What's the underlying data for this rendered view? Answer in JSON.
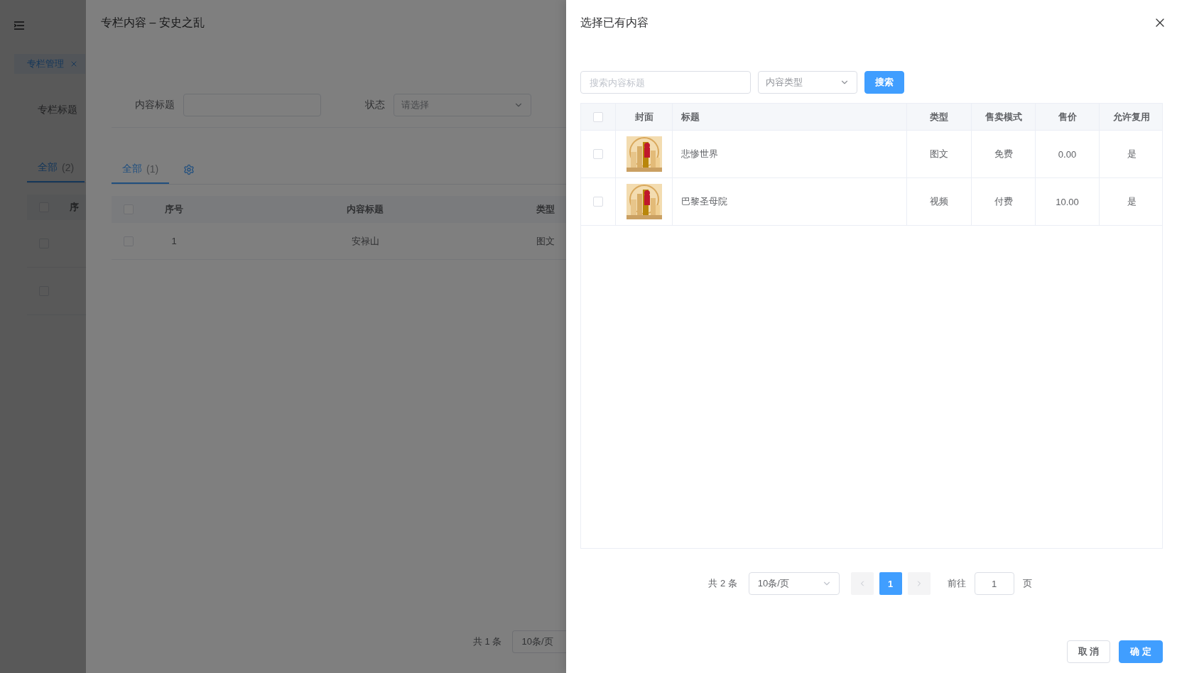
{
  "app": {
    "tags": [
      {
        "label": "专栏管理",
        "selected": true,
        "closable": true
      }
    ],
    "filter": {
      "label": "专栏标题"
    },
    "tabs": [
      {
        "label": "全部",
        "count": "(2)",
        "selected": true
      }
    ],
    "table": {
      "header_checked": false,
      "column_1": "序",
      "rows": [
        {
          "checked": false
        },
        {
          "checked": false
        }
      ]
    }
  },
  "column_drawer": {
    "title": "专栏内容 – 安史之乱",
    "filters": [
      {
        "kind": "input",
        "label": "内容标题"
      },
      {
        "kind": "select",
        "label": "状态",
        "placeholder": "请选择"
      }
    ],
    "tabs": [
      {
        "label": "全部",
        "count": "(1)",
        "selected": true
      }
    ],
    "table": {
      "header_checked": false,
      "columns": [
        "序号",
        "内容标题",
        "类型"
      ],
      "rows": [
        {
          "checked": false,
          "cells": [
            "1",
            "安禄山",
            "图文"
          ]
        }
      ]
    },
    "pagination": {
      "total": "共 1 条",
      "page_size": "10条/页"
    }
  },
  "select_drawer": {
    "title": "选择已有内容",
    "search": {
      "placeholder": "搜索内容标题"
    },
    "type_select": {
      "placeholder": "内容类型"
    },
    "search_button": "搜索",
    "table": {
      "header_checked": false,
      "columns": [
        "封面",
        "标题",
        "类型",
        "售卖模式",
        "售价",
        "允许复用"
      ],
      "rows": [
        {
          "checked": false,
          "title": "悲惨世界",
          "type": "图文",
          "mode": "免费",
          "price": "0.00",
          "reuse": "是"
        },
        {
          "checked": false,
          "title": "巴黎圣母院",
          "type": "视频",
          "mode": "付费",
          "price": "10.00",
          "reuse": "是"
        }
      ]
    },
    "pagination": {
      "total": "共 2 条",
      "page_size": "10条/页",
      "pages": [
        {
          "label": "1",
          "selected": true
        }
      ],
      "goto_label": "前往",
      "goto_value": "1",
      "goto_suffix": "页"
    },
    "buttons": [
      {
        "kind": "default",
        "label": "取 消"
      },
      {
        "kind": "primary",
        "label": "确 定"
      }
    ]
  }
}
